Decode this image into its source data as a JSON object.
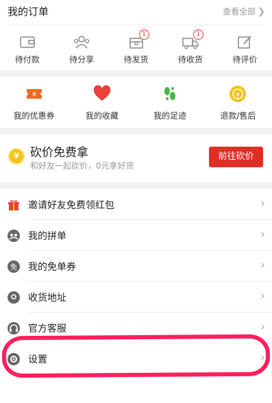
{
  "orders": {
    "title": "我的订单",
    "view_all": "查看全部",
    "items": [
      {
        "label": "待付款",
        "icon": "wallet-icon"
      },
      {
        "label": "待分享",
        "icon": "group-share-icon"
      },
      {
        "label": "待发货",
        "icon": "package-icon",
        "badge": "1"
      },
      {
        "label": "待收货",
        "icon": "truck-icon",
        "badge": "1"
      },
      {
        "label": "待评价",
        "icon": "edit-review-icon"
      }
    ]
  },
  "features": [
    {
      "label": "我的优惠券",
      "icon": "coupon-icon",
      "color": "#f06a1d"
    },
    {
      "label": "我的收藏",
      "icon": "heart-icon",
      "color": "#e9403b"
    },
    {
      "label": "我的足迹",
      "icon": "footprint-icon",
      "color": "#45b648"
    },
    {
      "label": "退款/售后",
      "icon": "refund-icon",
      "color": "#f4c31a"
    }
  ],
  "promo": {
    "title": "砍价免费拿",
    "subtitle": "和好友一起砍价，0元拿好货",
    "button": "前往砍价",
    "button_color": "#e02e24",
    "coin_symbol": "¥"
  },
  "menu": [
    {
      "label": "邀请好友免费领红包",
      "icon": "gift-icon"
    },
    {
      "label": "我的拼单",
      "icon": "group-order-icon"
    },
    {
      "label": "我的免单券",
      "icon": "free-coupon-icon"
    },
    {
      "label": "收货地址",
      "icon": "location-pin-icon"
    },
    {
      "label": "官方客服",
      "icon": "headset-icon"
    },
    {
      "label": "设置",
      "icon": "settings-icon"
    }
  ],
  "annotation": {
    "color": "#ff1f5e",
    "target": "设置"
  }
}
